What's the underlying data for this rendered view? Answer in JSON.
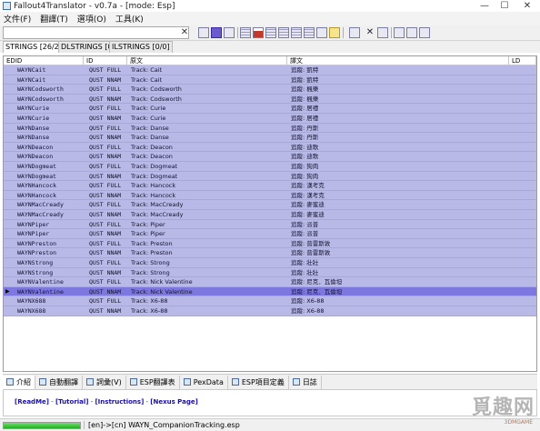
{
  "window": {
    "title": "Fallout4Translator - v0.7a - [mode: Esp]",
    "minimize": "—",
    "maximize": "☐",
    "close": "✕"
  },
  "menu": [
    "文件(F)",
    "翻譯(T)",
    "選項(O)",
    "工具(K)"
  ],
  "search": {
    "value": "",
    "clear_glyph": "✕"
  },
  "tabs": [
    "STRINGS [26/26]",
    "DLSTRINGS [0/0]",
    "ILSTRINGS [0/0]"
  ],
  "columns": [
    "EDID",
    "ID",
    "原文",
    "譯文",
    "LD"
  ],
  "rows": [
    {
      "edid": "WAYNCait",
      "id": "QUST FULL",
      "source": "Track: Cait",
      "target": "追蹤: 凱特"
    },
    {
      "edid": "WAYNCait",
      "id": "QUST NNAM",
      "source": "Track: Cait",
      "target": "追蹤: 凱特"
    },
    {
      "edid": "WAYNCodsworth",
      "id": "QUST FULL",
      "source": "Track: Codsworth",
      "target": "追蹤: 楓樂"
    },
    {
      "edid": "WAYNCodsworth",
      "id": "QUST NNAM",
      "source": "Track: Codsworth",
      "target": "追蹤: 楓樂"
    },
    {
      "edid": "WAYNCurie",
      "id": "QUST FULL",
      "source": "Track: Curie",
      "target": "追蹤: 居禮"
    },
    {
      "edid": "WAYNCurie",
      "id": "QUST NNAM",
      "source": "Track: Curie",
      "target": "追蹤: 居禮"
    },
    {
      "edid": "WAYNDanse",
      "id": "QUST FULL",
      "source": "Track: Danse",
      "target": "追蹤: 丹斯"
    },
    {
      "edid": "WAYNDanse",
      "id": "QUST NNAM",
      "source": "Track: Danse",
      "target": "追蹤: 丹斯"
    },
    {
      "edid": "WAYNDeacon",
      "id": "QUST FULL",
      "source": "Track: Deacon",
      "target": "追蹤: 迪歌"
    },
    {
      "edid": "WAYNDeacon",
      "id": "QUST NNAM",
      "source": "Track: Deacon",
      "target": "追蹤: 迪歌"
    },
    {
      "edid": "WAYNDogmeat",
      "id": "QUST FULL",
      "source": "Track: Dogmeat",
      "target": "追蹤: 狗肉"
    },
    {
      "edid": "WAYNDogmeat",
      "id": "QUST NNAM",
      "source": "Track: Dogmeat",
      "target": "追蹤: 狗肉"
    },
    {
      "edid": "WAYNHancock",
      "id": "QUST FULL",
      "source": "Track: Hancock",
      "target": "追蹤: 漢考克"
    },
    {
      "edid": "WAYNHancock",
      "id": "QUST NNAM",
      "source": "Track: Hancock",
      "target": "追蹤: 漢考克"
    },
    {
      "edid": "WAYNMacCready",
      "id": "QUST FULL",
      "source": "Track: MacCready",
      "target": "追蹤: 麥蜜迪"
    },
    {
      "edid": "WAYNMacCready",
      "id": "QUST NNAM",
      "source": "Track: MacCready",
      "target": "追蹤: 麥蜜迪"
    },
    {
      "edid": "WAYNPiper",
      "id": "QUST FULL",
      "source": "Track: Piper",
      "target": "追蹤: 派普"
    },
    {
      "edid": "WAYNPiper",
      "id": "QUST NNAM",
      "source": "Track: Piper",
      "target": "追蹤: 派普"
    },
    {
      "edid": "WAYNPreston",
      "id": "QUST FULL",
      "source": "Track: Preston",
      "target": "追蹤: 普雷斯敦"
    },
    {
      "edid": "WAYNPreston",
      "id": "QUST NNAM",
      "source": "Track: Preston",
      "target": "追蹤: 普雷斯敦"
    },
    {
      "edid": "WAYNStrong",
      "id": "QUST FULL",
      "source": "Track: Strong",
      "target": "追蹤: 壯壯"
    },
    {
      "edid": "WAYNStrong",
      "id": "QUST NNAM",
      "source": "Track: Strong",
      "target": "追蹤: 壯壯"
    },
    {
      "edid": "WAYNValentine",
      "id": "QUST FULL",
      "source": "Track: Nick Valentine",
      "target": "追蹤: 尼克．瓦倫坦"
    },
    {
      "edid": "WAYNValentine",
      "id": "QUST NNAM",
      "source": "Track: Nick Valentine",
      "target": "追蹤: 尼克．瓦倫坦",
      "selected": true
    },
    {
      "edid": "WAYNX688",
      "id": "QUST FULL",
      "source": "Track: X6-88",
      "target": "追蹤: X6-88"
    },
    {
      "edid": "WAYNX688",
      "id": "QUST NNAM",
      "source": "Track: X6-88",
      "target": "追蹤: X6-88"
    }
  ],
  "row_marker": "▶",
  "bottom_tabs": [
    "介紹",
    "自動翻譯",
    "詞彙(V)",
    "ESP翻譯表",
    "PexData",
    "ESP項目定義",
    "日誌"
  ],
  "links": [
    "[ReadMe]",
    "[Tutorial]",
    "[Instructions]",
    "[Nexus Page]"
  ],
  "link_separator": " - ",
  "status": {
    "progress": 1.0,
    "text": "[en]->[cn] WAYN_CompanionTracking.esp"
  },
  "watermark": {
    "big": "覓趣网",
    "small": "3DMGAME"
  },
  "colors": {
    "row_bg": "#b9b9e8",
    "row_selected": "#7d77e0",
    "accent": "#6a5acd"
  }
}
